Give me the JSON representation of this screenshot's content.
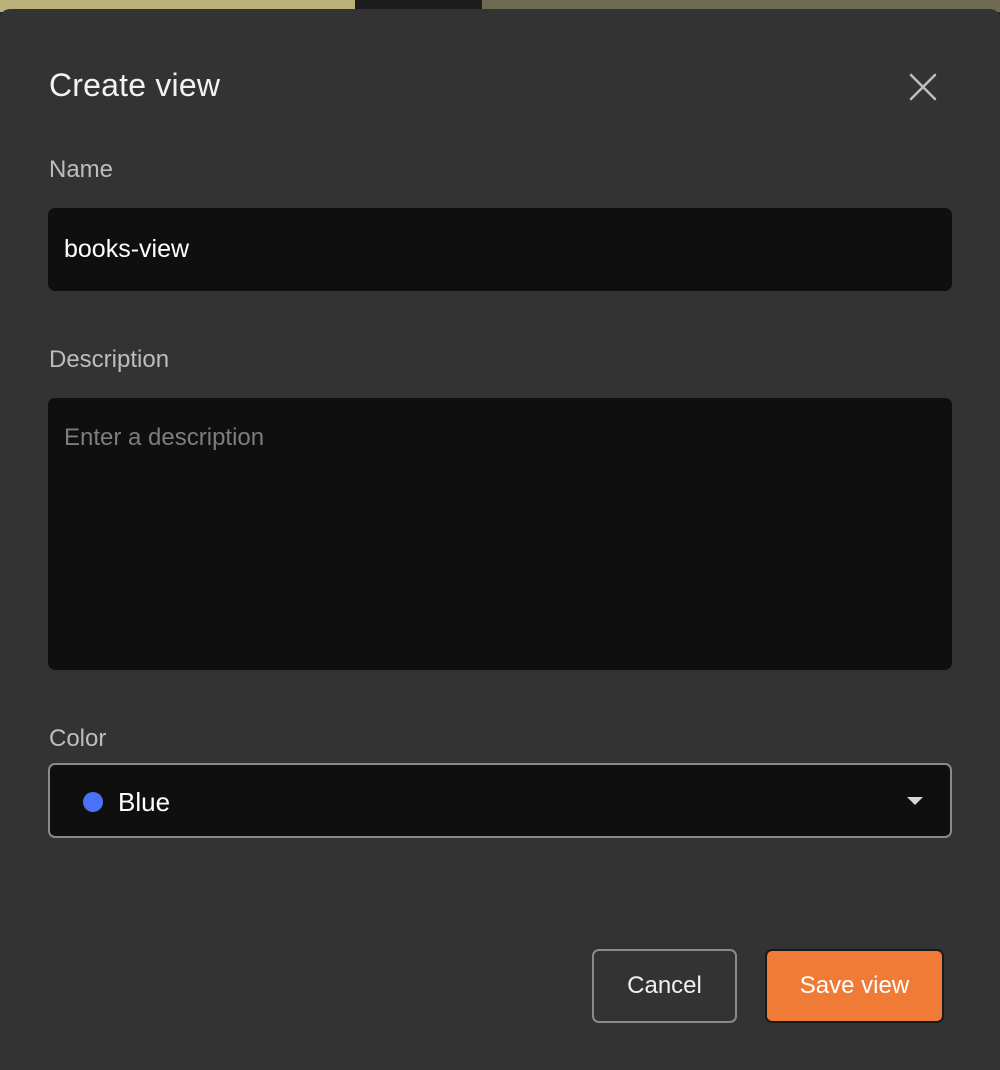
{
  "dialog": {
    "title": "Create view",
    "close_icon": "close-icon"
  },
  "form": {
    "name": {
      "label": "Name",
      "value": "books-view"
    },
    "description": {
      "label": "Description",
      "value": "",
      "placeholder": "Enter a description"
    },
    "color": {
      "label": "Color",
      "selected": "Blue",
      "swatch_color": "#4a72f5",
      "dropdown_icon": "chevron-down-icon"
    }
  },
  "actions": {
    "cancel_label": "Cancel",
    "save_label": "Save view",
    "save_color": "#ef7b36"
  }
}
